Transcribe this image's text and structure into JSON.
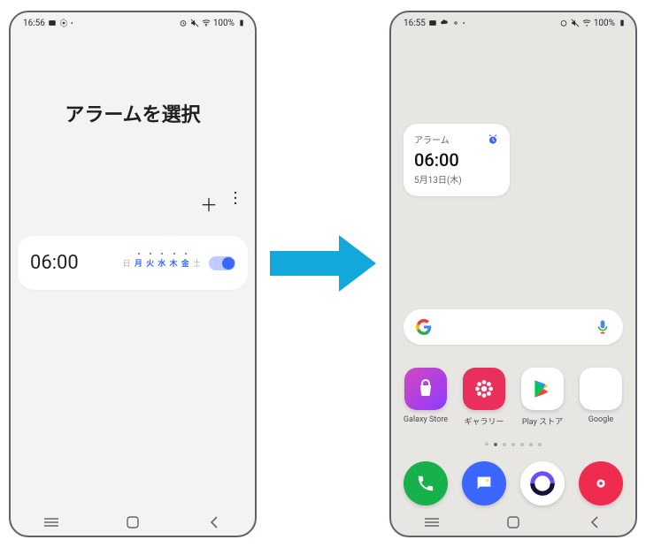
{
  "phone_left": {
    "status": {
      "time": "16:56",
      "battery": "100%"
    },
    "title": "アラームを選択",
    "alarm": {
      "time": "06:00",
      "days": {
        "sun": "日",
        "mon": "月",
        "tue": "火",
        "wed": "水",
        "thu": "木",
        "fri": "金",
        "sat": "土"
      },
      "toggle_on": true
    }
  },
  "phone_right": {
    "status": {
      "time": "16:55",
      "battery": "100%"
    },
    "widget": {
      "title": "アラーム",
      "time": "06:00",
      "date": "5月13日(木)"
    },
    "apps": {
      "galaxy_store": "Galaxy Store",
      "gallery": "ギャラリー",
      "play_store": "Play ストア",
      "google": "Google"
    }
  }
}
